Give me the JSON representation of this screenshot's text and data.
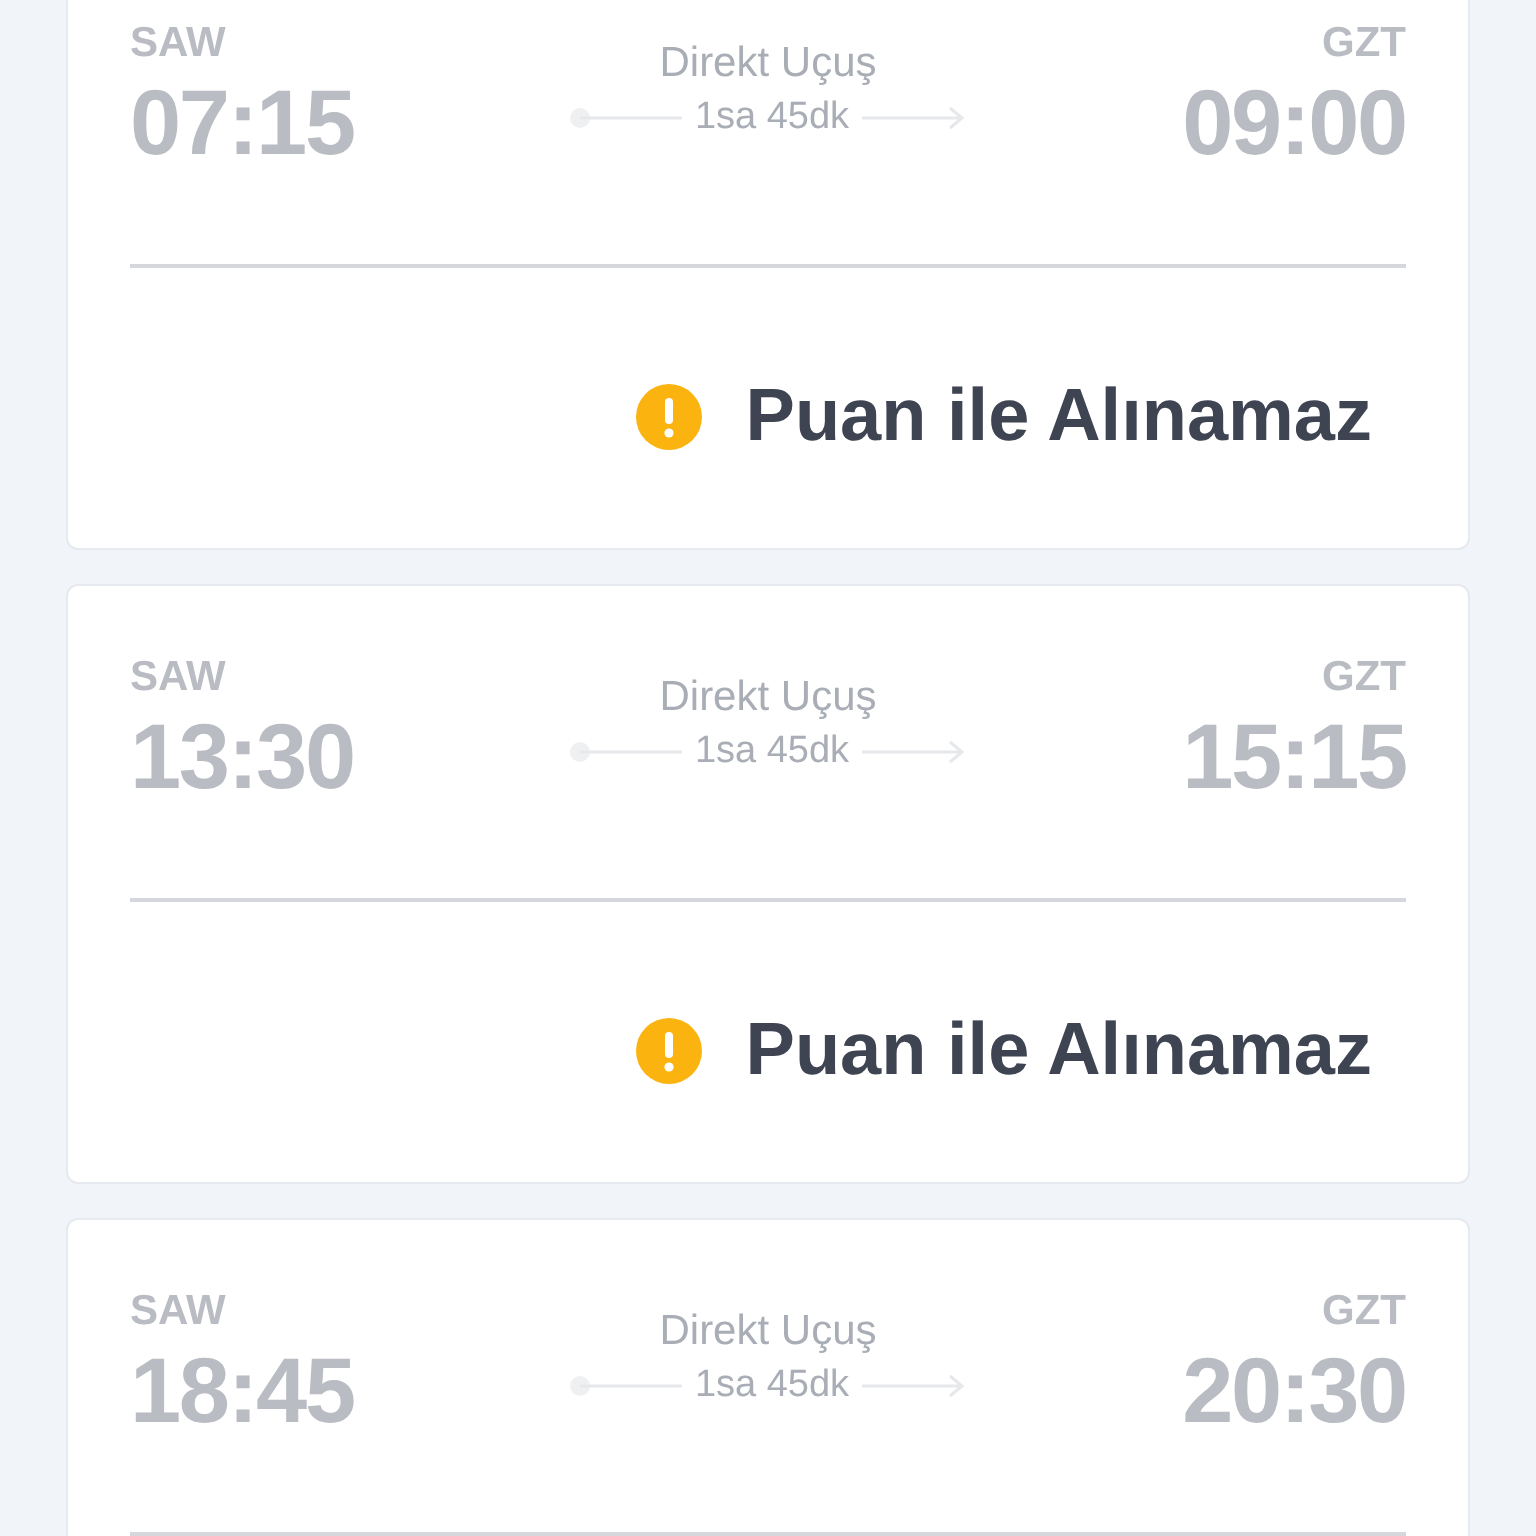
{
  "flights": [
    {
      "from": "SAW",
      "to": "GZT",
      "depart": "07:15",
      "arrive": "09:00",
      "type": "Direkt Uçuş",
      "duration": "1sa 45dk",
      "notice": "Puan ile Alınamaz"
    },
    {
      "from": "SAW",
      "to": "GZT",
      "depart": "13:30",
      "arrive": "15:15",
      "type": "Direkt Uçuş",
      "duration": "1sa 45dk",
      "notice": "Puan ile Alınamaz"
    },
    {
      "from": "SAW",
      "to": "GZT",
      "depart": "18:45",
      "arrive": "20:30",
      "type": "Direkt Uçuş",
      "duration": "1sa 45dk"
    }
  ]
}
